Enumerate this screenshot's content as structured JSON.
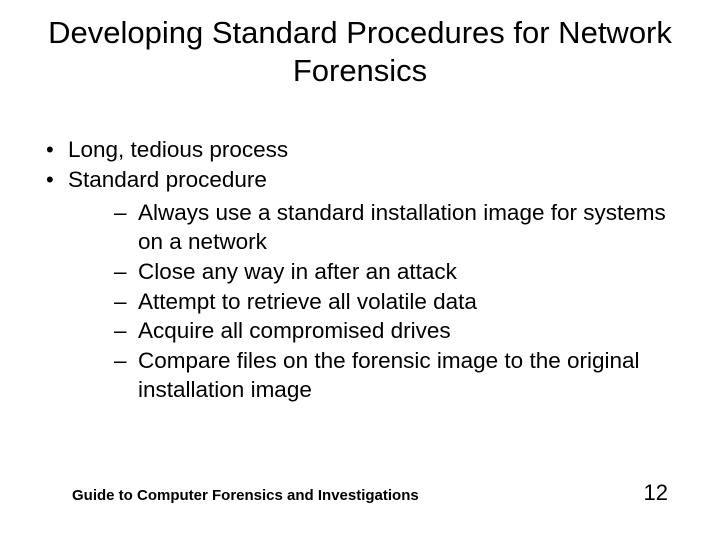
{
  "title": "Developing Standard Procedures for Network Forensics",
  "bullets": {
    "b1": "Long, tedious process",
    "b2": "Standard procedure",
    "sub": {
      "s1": "Always use a standard installation image for systems on a network",
      "s2": "Close any way in after an attack",
      "s3": "Attempt to retrieve all volatile data",
      "s4": "Acquire all compromised drives",
      "s5": "Compare files on the forensic image to the original installation image"
    }
  },
  "footer": {
    "source": "Guide to Computer Forensics and Investigations",
    "page": "12"
  }
}
